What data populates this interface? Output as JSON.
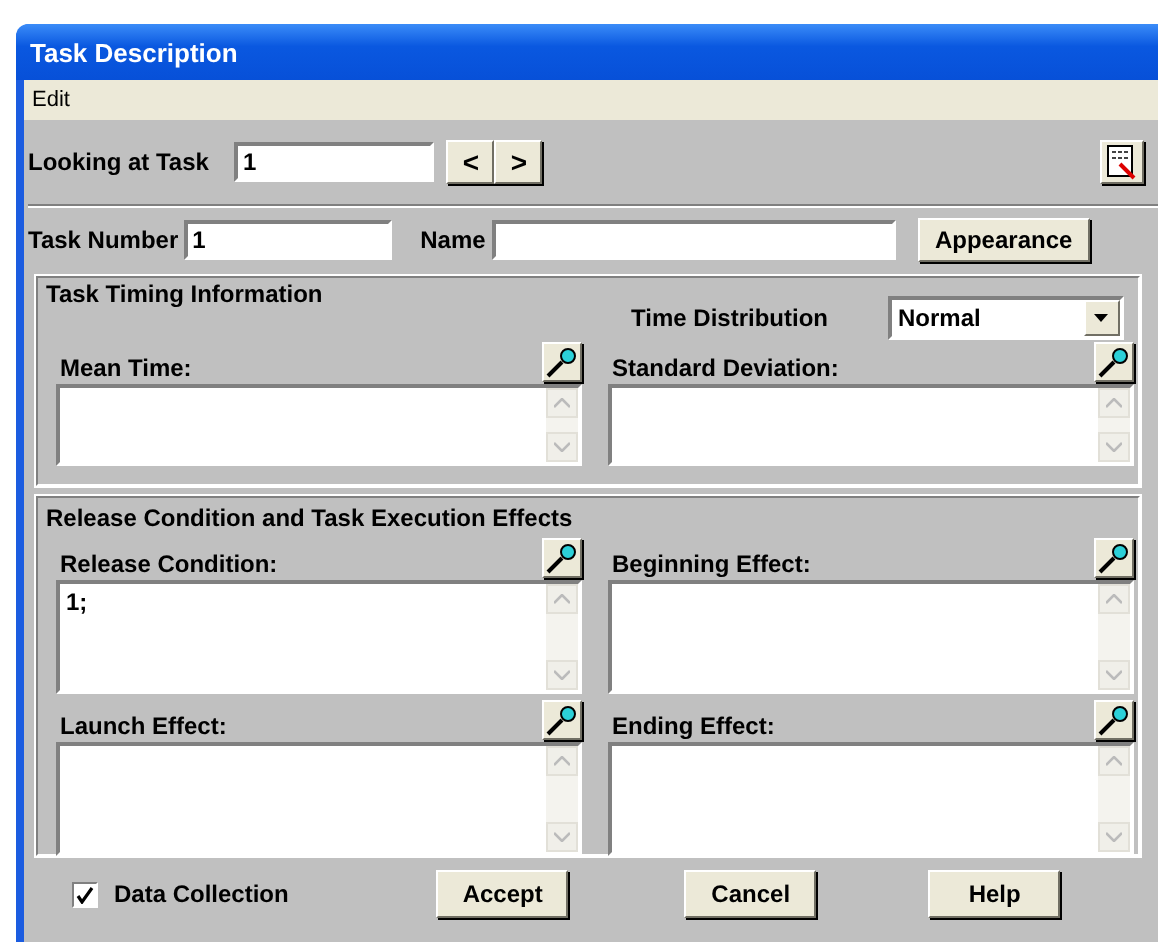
{
  "window": {
    "title": "Task Description"
  },
  "menu": [
    "Edit"
  ],
  "looking_at_task": {
    "label": "Looking at Task",
    "value": "1",
    "prev": "<",
    "next": ">"
  },
  "task_number": {
    "label": "Task Number",
    "value": "1"
  },
  "name": {
    "label": "Name"
  },
  "appearance_button": "Appearance",
  "timing": {
    "title": "Task Timing Information",
    "distribution": {
      "label": "Time Distribution",
      "value": "Normal"
    },
    "fields": [
      {
        "label": "Mean Time:"
      },
      {
        "label": "Standard Deviation:"
      }
    ]
  },
  "effects": {
    "title": "Release Condition and Task Execution Effects",
    "fields": [
      {
        "label": "Release Condition:",
        "value": "1;"
      },
      {
        "label": "Beginning Effect:"
      },
      {
        "label": "Launch Effect:"
      },
      {
        "label": "Ending Effect:"
      }
    ]
  },
  "data_collection": {
    "label": "Data Collection",
    "checked": true
  },
  "buttons": [
    "Accept",
    "Cancel",
    "Help"
  ]
}
